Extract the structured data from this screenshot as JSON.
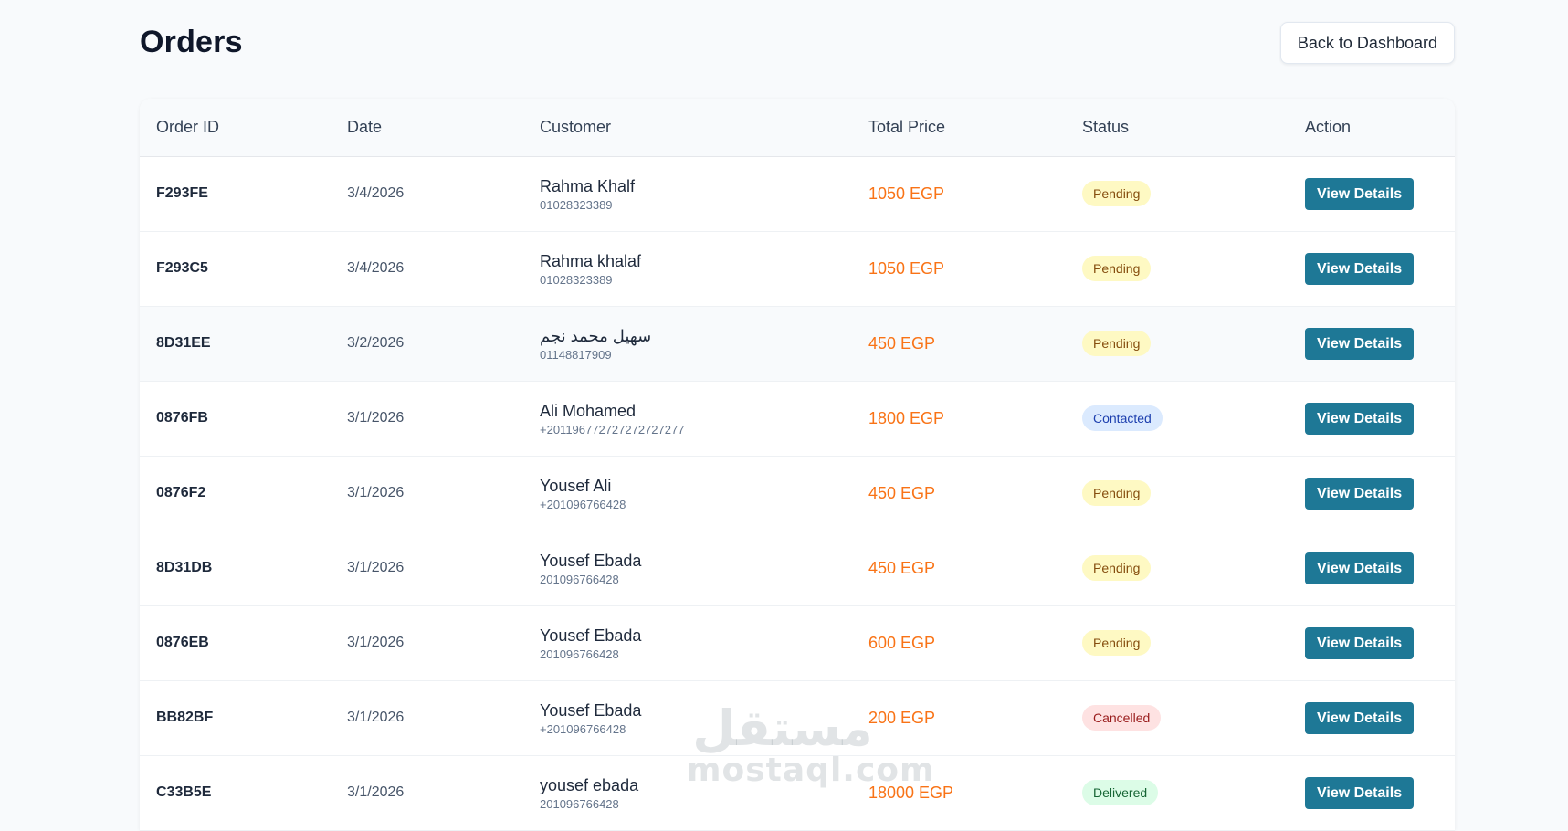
{
  "header": {
    "title": "Orders",
    "back_label": "Back to Dashboard"
  },
  "table": {
    "columns": [
      "Order ID",
      "Date",
      "Customer",
      "Total Price",
      "Status",
      "Action"
    ],
    "action_label": "View Details",
    "rows": [
      {
        "id": "F293FE",
        "date": "3/4/2026",
        "name": "Rahma Khalf",
        "phone": "01028323389",
        "price": "1050 EGP",
        "status": "Pending",
        "status_key": "pending"
      },
      {
        "id": "F293C5",
        "date": "3/4/2026",
        "name": "Rahma khalaf",
        "phone": "01028323389",
        "price": "1050 EGP",
        "status": "Pending",
        "status_key": "pending"
      },
      {
        "id": "8D31EE",
        "date": "3/2/2026",
        "name": "سهيل محمد نجم",
        "phone": "01148817909",
        "price": "450 EGP",
        "status": "Pending",
        "status_key": "pending"
      },
      {
        "id": "0876FB",
        "date": "3/1/2026",
        "name": "Ali Mohamed",
        "phone": "+201196772727272727277",
        "price": "1800 EGP",
        "status": "Contacted",
        "status_key": "contacted"
      },
      {
        "id": "0876F2",
        "date": "3/1/2026",
        "name": "Yousef Ali",
        "phone": "+201096766428",
        "price": "450 EGP",
        "status": "Pending",
        "status_key": "pending"
      },
      {
        "id": "8D31DB",
        "date": "3/1/2026",
        "name": "Yousef Ebada",
        "phone": "201096766428",
        "price": "450 EGP",
        "status": "Pending",
        "status_key": "pending"
      },
      {
        "id": "0876EB",
        "date": "3/1/2026",
        "name": "Yousef Ebada",
        "phone": "201096766428",
        "price": "600 EGP",
        "status": "Pending",
        "status_key": "pending"
      },
      {
        "id": "BB82BF",
        "date": "3/1/2026",
        "name": "Yousef Ebada",
        "phone": "+201096766428",
        "price": "200 EGP",
        "status": "Cancelled",
        "status_key": "cancelled"
      },
      {
        "id": "C33B5E",
        "date": "3/1/2026",
        "name": "yousef ebada",
        "phone": "201096766428",
        "price": "18000 EGP",
        "status": "Delivered",
        "status_key": "delivered"
      }
    ]
  },
  "watermark": {
    "arabic": "مستقل",
    "latin": "mostaql.com"
  },
  "colors": {
    "accent_button": "#1e7896",
    "price": "#f97316",
    "pending_bg": "#fef9c3",
    "contacted_bg": "#dbeafe",
    "cancelled_bg": "#fee2e2",
    "delivered_bg": "#dcfce7"
  }
}
